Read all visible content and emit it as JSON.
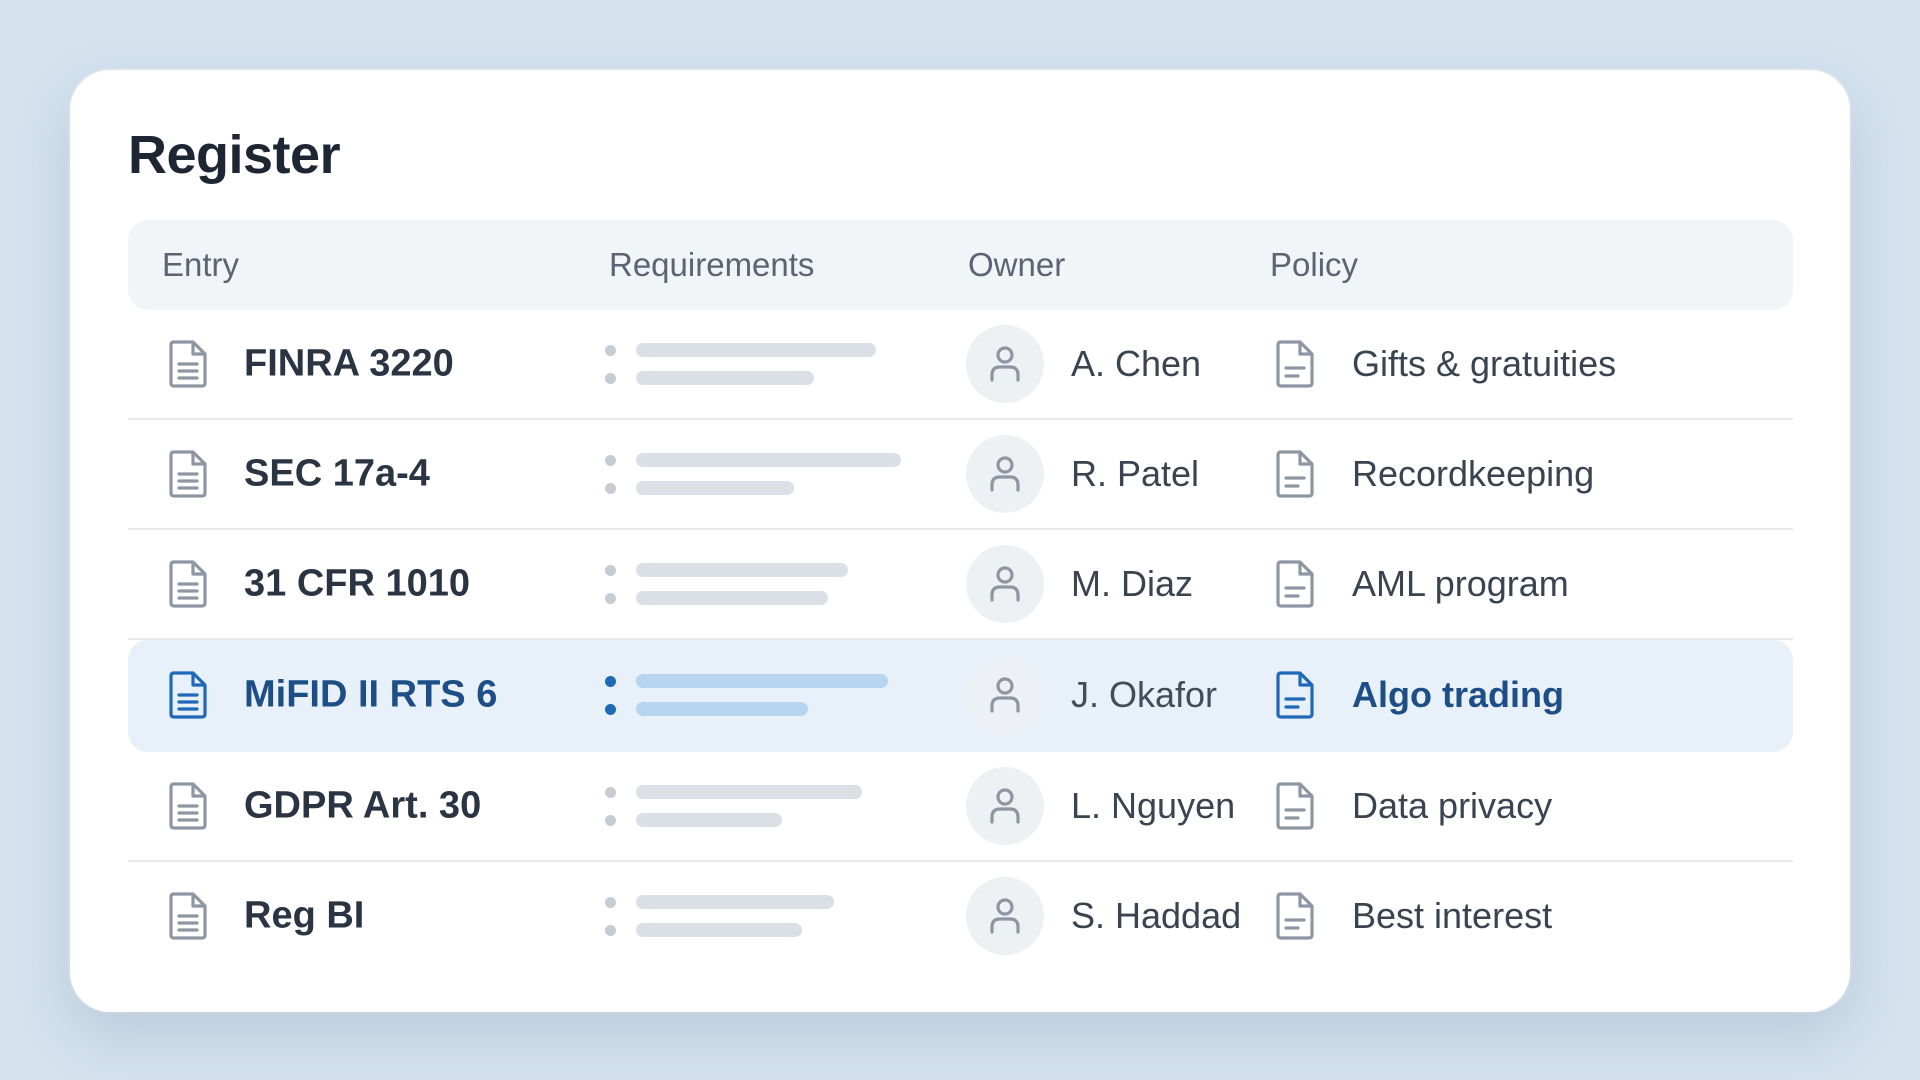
{
  "title": "Register",
  "columns": {
    "entry": "Entry",
    "requirements": "Requirements",
    "owner": "Owner",
    "policy": "Policy"
  },
  "rows": [
    {
      "entry": "FINRA 3220",
      "owner": "A. Chen",
      "policy": "Gifts & gratuities",
      "selected": false
    },
    {
      "entry": "SEC 17a-4",
      "owner": "R. Patel",
      "policy": "Recordkeeping",
      "selected": false
    },
    {
      "entry": "31 CFR 1010",
      "owner": "M. Diaz",
      "policy": "AML program",
      "selected": false
    },
    {
      "entry": "MiFID II RTS 6",
      "owner": "J. Okafor",
      "policy": "Algo trading",
      "selected": true
    },
    {
      "entry": "GDPR Art. 30",
      "owner": "L. Nguyen",
      "policy": "Data privacy",
      "selected": false
    },
    {
      "entry": "Reg BI",
      "owner": "S. Haddad",
      "policy": "Best interest",
      "selected": false
    }
  ],
  "icons": {
    "entry": "document-icon",
    "owner": "user-icon",
    "policy": "document-icon"
  },
  "colors": {
    "accent": "#1f69b8",
    "selected_row_bg": "#e8f0fa",
    "selected_text": "#1d4f86"
  }
}
